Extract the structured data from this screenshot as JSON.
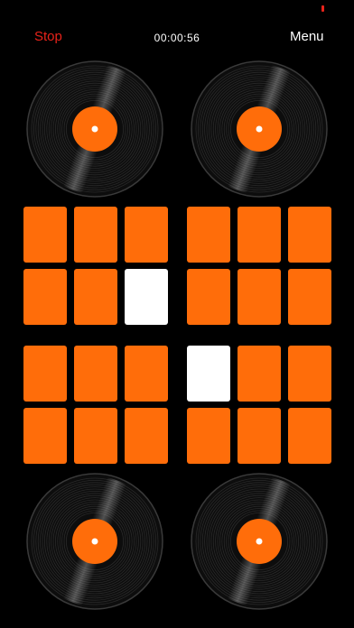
{
  "app": {
    "stop_label": "Stop",
    "timer": "00:00:56",
    "menu_label": "Menu"
  },
  "colors": {
    "accent": "#ff6d0a",
    "active_pad": "#ffffff",
    "stop": "#e8231a",
    "background": "#000000",
    "vinyl": "#0d0d0d"
  },
  "turntables": [
    {
      "id": "top-left",
      "highlight_angle": 200
    },
    {
      "id": "top-right",
      "highlight_angle": 20
    },
    {
      "id": "bottom-left",
      "highlight_angle": 200
    },
    {
      "id": "bottom-right",
      "highlight_angle": 20
    }
  ],
  "pad_banks": [
    {
      "id": "top-left",
      "pads": [
        false,
        false,
        false,
        false,
        false,
        true
      ]
    },
    {
      "id": "top-right",
      "pads": [
        false,
        false,
        false,
        false,
        false,
        false
      ]
    },
    {
      "id": "bottom-left",
      "pads": [
        false,
        false,
        false,
        false,
        false,
        false
      ]
    },
    {
      "id": "bottom-right",
      "pads": [
        true,
        false,
        false,
        false,
        false,
        false
      ]
    }
  ]
}
